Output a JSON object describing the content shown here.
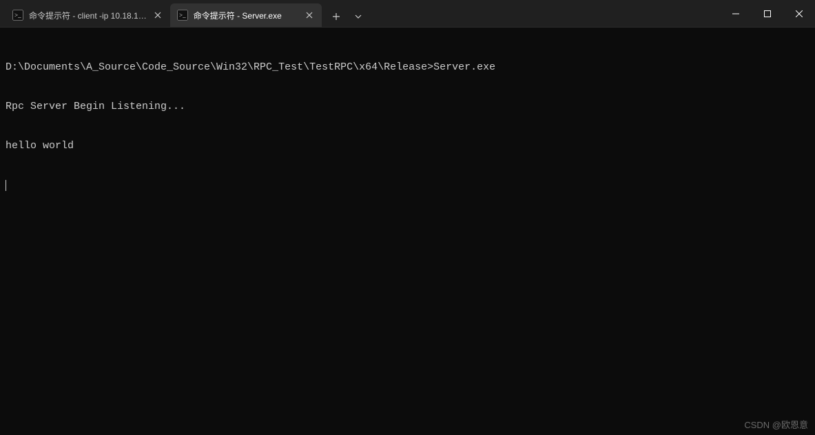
{
  "tabs": [
    {
      "label": "命令提示符 - client  -ip 10.18.1…",
      "active": false
    },
    {
      "label": "命令提示符 - Server.exe",
      "active": true
    }
  ],
  "newTabGlyph": "+",
  "dropdownGlyph": "˅",
  "closeGlyph": "✕",
  "windowControls": {
    "minimize": "—",
    "maximize": "▢",
    "close": "✕"
  },
  "terminal": {
    "lines": [
      "D:\\Documents\\A_Source\\Code_Source\\Win32\\RPC_Test\\TestRPC\\x64\\Release>Server.exe",
      "Rpc Server Begin Listening...",
      "hello world"
    ]
  },
  "watermark": "CSDN @欧恩意"
}
